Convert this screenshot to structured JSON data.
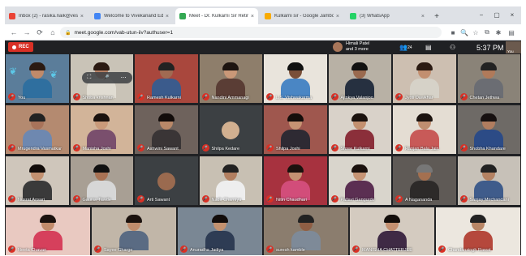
{
  "browser": {
    "tabs": [
      {
        "title": "Inbox (2) - rasika.naik@ves.ac.in",
        "favicon_color": "#ea4335"
      },
      {
        "title": "Welcome to Vivekanand Education Society",
        "favicon_color": "#4285f4"
      },
      {
        "title": "Meet - Dr. Kulkarni Sir Retirement",
        "favicon_color": "#34a853",
        "active": true
      },
      {
        "title": "Kulkarni sir - Google Jamboard",
        "favicon_color": "#f9ab00"
      },
      {
        "title": "(3) WhatsApp",
        "favicon_color": "#25d366"
      }
    ],
    "new_tab": "+",
    "window_controls": [
      "−",
      "▢",
      "×"
    ],
    "url": "meet.google.com/vab-utun-iiv?authuser=1",
    "nav_icons": [
      "←",
      "→",
      "⟳",
      "⌂"
    ],
    "right_icons": [
      "■",
      "🔍",
      "☆",
      "⧉",
      "✱",
      "▤"
    ]
  },
  "meet": {
    "rec_label": "REC",
    "host_name": "Himali Patel",
    "host_more": "and 3 more",
    "participant_count": "24",
    "time": "5:37 PM",
    "self_label": "You",
    "hover_icons": [
      "⛶",
      "🎤",
      "⋯"
    ],
    "tile_mic_icon": "mic-off-icon",
    "participants": [
      {
        "name": "You",
        "bg": "#5b7d9a",
        "skin": "#c08a6a",
        "shirt": "#2f6f9f",
        "hair": "#2b1a12"
      },
      {
        "name": "Shoba krishnan",
        "bg": "#c9c3b7",
        "skin": "#b58064",
        "shirt": "#e0dcd2",
        "hair": "#2b1a12"
      },
      {
        "name": "Ramesh Kulkarni",
        "bg": "#a9473d",
        "skin": "#a06a52",
        "shirt": "#3b5b8c",
        "hair": "#222"
      },
      {
        "name": "Nandini Ammanagi",
        "bg": "#8e7e6b",
        "skin": "#c99878",
        "shirt": "#5a3d35",
        "hair": "#1d1410"
      },
      {
        "name": "L.S. Vishwakarma",
        "bg": "#e9e4dc",
        "skin": "#7a4f38",
        "shirt": "#4a86c4",
        "hair": "#111"
      },
      {
        "name": "Ajinkya Valanjoo",
        "bg": "#b8b1a5",
        "skin": "#9a6a4f",
        "shirt": "#263040",
        "hair": "#111"
      },
      {
        "name": "Jyoti Dawkhar",
        "bg": "#cdbfb1",
        "skin": "#c28f70",
        "shirt": "#d6d2c8",
        "hair": "#2b1a12"
      },
      {
        "name": "Chetan Jethwa",
        "bg": "#8a8378",
        "skin": "#b07a5a",
        "shirt": "#6b6d73",
        "hair": "#222"
      },
      {
        "name": "Mrugendra Vasmatkar",
        "bg": "#b48a70",
        "skin": "#a8735a",
        "shirt": "#6e88b0",
        "hair": "#222"
      },
      {
        "name": "Manisha Joshi",
        "bg": "#d2b499",
        "skin": "#c99a7a",
        "shirt": "#7a4f6d",
        "hair": "#1a120e"
      },
      {
        "name": "Ashwini Sawant",
        "bg": "#6e625c",
        "skin": "#b98868",
        "shirt": "#3a3536",
        "hair": "#120c0a"
      },
      {
        "name": "Shilpa Kedare",
        "bg": "#3c4043",
        "skin": "#d2b090",
        "shirt": "#3c4043",
        "hair": "#222",
        "dark": true
      },
      {
        "name": "Shilpa Joshi",
        "bg": "#9f574e",
        "skin": "#c79373",
        "shirt": "#2e2a33",
        "hair": "#150e0b"
      },
      {
        "name": "Shree Kulkarni",
        "bg": "#d9d2c9",
        "skin": "#c3906f",
        "shirt": "#8b2f3a",
        "hair": "#1b120e"
      },
      {
        "name": "Ranjan Bala Jain",
        "bg": "#e4ddd3",
        "skin": "#bf8e70",
        "shirt": "#c85a58",
        "hair": "#1c130f"
      },
      {
        "name": "Shobha Khandare",
        "bg": "#6e6a66",
        "skin": "#b07d5f",
        "shirt": "#2c4b86",
        "hair": "#161010"
      },
      {
        "name": "Nusrat Ansari",
        "bg": "#cfc6bb",
        "skin": "#c29070",
        "shirt": "#3a3a3a",
        "hair": "#120c0a"
      },
      {
        "name": "Gaurav Tawde",
        "bg": "#a89f94",
        "skin": "#a87254",
        "shirt": "#d7d7d7",
        "hair": "#111"
      },
      {
        "name": "Arti Sawant",
        "bg": "#3c4043",
        "skin": "#9a6a4f",
        "shirt": "#3c4043",
        "hair": "#222",
        "dark": true
      },
      {
        "name": "Nadir Charniya",
        "bg": "#c8c0b3",
        "skin": "#b27f60",
        "shirt": "#eeeeee",
        "hair": "#222"
      },
      {
        "name": "Nitin Chaudhari",
        "bg": "#a7323f",
        "skin": "#c49272",
        "shirt": "#d24d7a",
        "hair": "#1b120e"
      },
      {
        "name": "Pallavi Gangurde",
        "bg": "#d9d5cc",
        "skin": "#c69474",
        "shirt": "#5b2f52",
        "hair": "#1a110d"
      },
      {
        "name": "A Nagananda",
        "bg": "#5f5a56",
        "skin": "#a47050",
        "shirt": "#2d2a29",
        "hair": "#777"
      },
      {
        "name": "Sanjay Mirchandani",
        "bg": "#c7c1b8",
        "skin": "#b48263",
        "shirt": "#3f5c8b",
        "hair": "#222"
      },
      {
        "name": "Neeta Chavan",
        "bg": "#e9c9c1",
        "skin": "#c18b6b",
        "shirt": "#d6405c",
        "hair": "#1b120e"
      },
      {
        "name": "Sayee Gharge",
        "bg": "#c1b6a8",
        "skin": "#c08c6c",
        "shirt": "#5a6b83",
        "hair": "#1b120e"
      },
      {
        "name": "Anuradha Jadiya",
        "bg": "#7a8794",
        "skin": "#c3916f",
        "shirt": "#2e3c54",
        "hair": "#120c0a"
      },
      {
        "name": "suresh kamble",
        "bg": "#8b7d6e",
        "skin": "#8f5e44",
        "shirt": "#7e8a98",
        "hair": "#222"
      },
      {
        "name": "MANISHA CHATTERJEE",
        "bg": "#d4cbc0",
        "skin": "#c49070",
        "shirt": "#3f2a45",
        "hair": "#130d0a"
      },
      {
        "name": "Chandansingh Rawat",
        "bg": "#ece7df",
        "skin": "#b88666",
        "shirt": "#b5483c",
        "hair": "#222"
      }
    ]
  }
}
